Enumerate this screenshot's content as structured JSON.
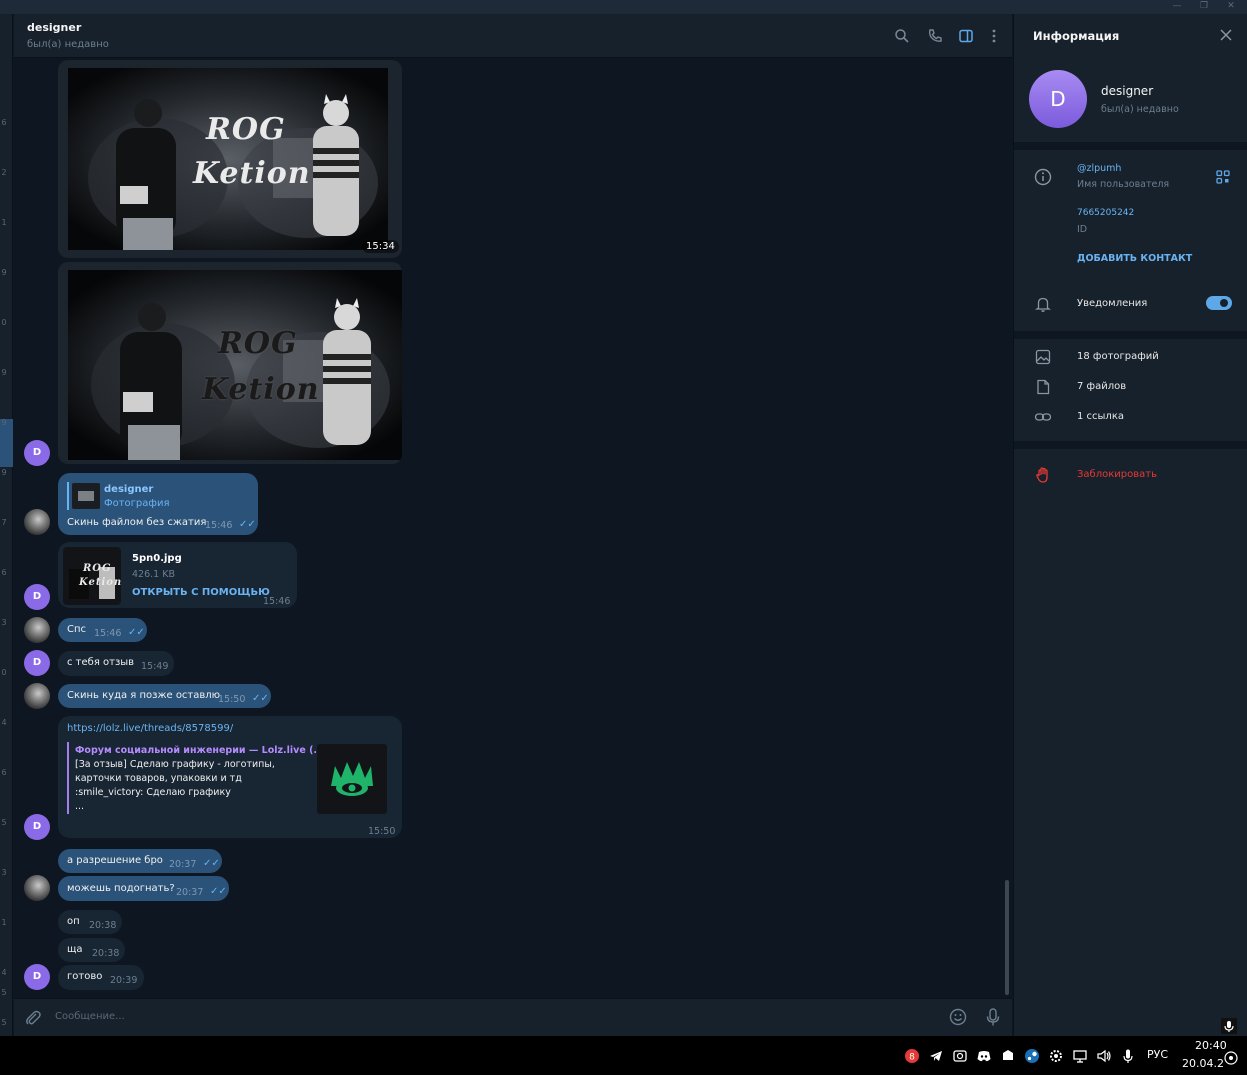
{
  "chat": {
    "name": "designer",
    "status": "был(а) недавно"
  },
  "messages": {
    "photo1_time": "15:34",
    "reply": {
      "quote_name": "designer",
      "quote_type": "Фотография",
      "text": "Скинь файлом без сжатия",
      "time": "15:46"
    },
    "file": {
      "name": "5pn0.jpg",
      "size": "426.1 KB",
      "action": "ОТКРЫТЬ С ПОМОЩЬЮ",
      "time": "15:46"
    },
    "m1": {
      "text": "Спс",
      "time": "15:46"
    },
    "m2": {
      "text": "с тебя отзыв",
      "time": "15:49"
    },
    "m3": {
      "text": "Скинь куда я позже оставлю",
      "time": "15:50"
    },
    "linkmsg": {
      "url": "https://lolz.live/threads/8578599/",
      "preview_title": "Форум социальной инженерии — Lolz.live (...",
      "preview_line1": "[За отзыв] Сделаю графику - логотипы,",
      "preview_line2": "карточки товаров, упаковки и тд",
      "preview_line3": ":smile_victory: Сделаю графику",
      "preview_line4": "...",
      "time": "15:50"
    },
    "m4": {
      "text": "а разрешение бро",
      "time": "20:37"
    },
    "m5": {
      "text": "можешь подогнать?",
      "time": "20:37"
    },
    "m6": {
      "text": "оп",
      "time": "20:38"
    },
    "m7": {
      "text": "ща",
      "time": "20:38"
    },
    "m8": {
      "text": "готово",
      "time": "20:39"
    },
    "photo_caption_top": "ROG",
    "photo_caption_bottom": "Ketion"
  },
  "avatar_letter": "D",
  "composer": {
    "placeholder": "Сообщение..."
  },
  "info_panel": {
    "title": "Информация",
    "name": "designer",
    "status": "был(а) недавно",
    "username": "@zlpumh",
    "username_label": "Имя пользователя",
    "id": "7665205242",
    "id_label": "ID",
    "add_contact": "ДОБАВИТЬ КОНТАКТ",
    "notifications": "Уведомления",
    "notifications_on": true,
    "photos": "18 фотографий",
    "files": "7 файлов",
    "links": "1 ссылка",
    "block": "Заблокировать"
  },
  "left_strip_numbers": [
    "6",
    "2",
    "1",
    "9",
    "0",
    "9",
    "9",
    "9",
    "7",
    "6",
    "3",
    "0",
    "4",
    "6",
    "5",
    "3",
    "1",
    "4",
    "5",
    "5"
  ],
  "taskbar": {
    "language": "РУС",
    "time": "20:40",
    "date": "20.04.2"
  },
  "colors": {
    "accent": "#6ab3f3",
    "outgoing": "#2b5278",
    "incoming": "#182533",
    "avatar": "#8b6ae8",
    "danger": "#e53935"
  }
}
